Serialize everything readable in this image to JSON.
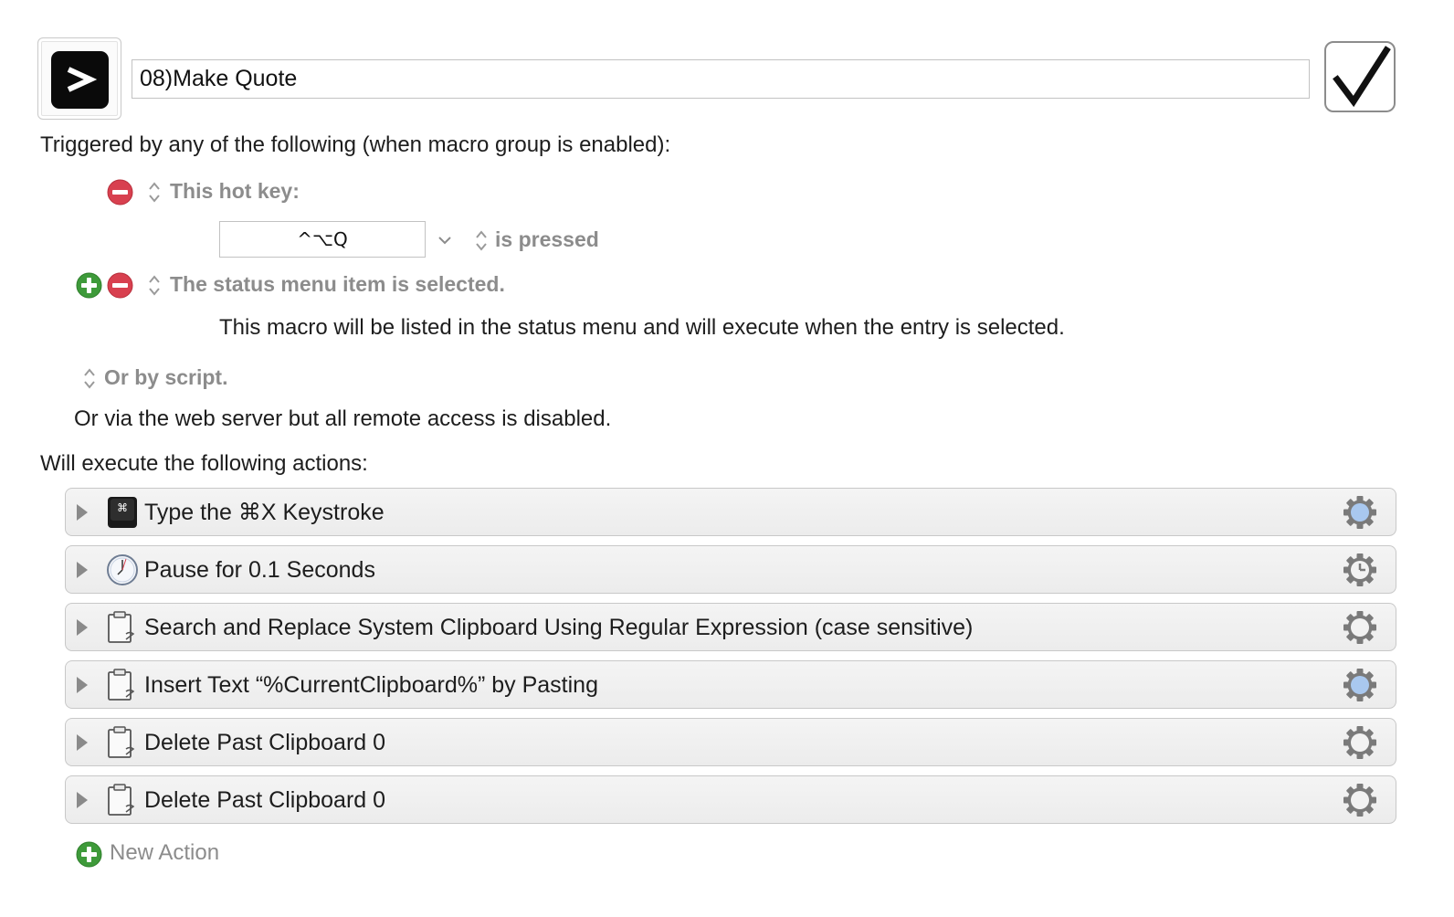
{
  "macro": {
    "name": "08)Make Quote",
    "icon": "terminal-icon",
    "enabled": true
  },
  "triggers": {
    "heading": "Triggered by any of the following (when macro group is enabled):",
    "hotkey_label": "This hot key:",
    "hotkey_value": "^⌥Q",
    "hotkey_state": "is pressed",
    "status_menu_label": "The status menu item is selected.",
    "status_menu_note": "This macro will be listed in the status menu and will execute when the entry is selected.",
    "script_label": "Or by script.",
    "web_server_note": "Or via the web server but all remote access is disabled."
  },
  "actions_heading": "Will execute the following actions:",
  "actions": [
    {
      "label": "Type the ⌘X Keystroke",
      "icon": "keystroke-icon",
      "gear": "gear-icon-highlighted"
    },
    {
      "label": "Pause for 0.1 Seconds",
      "icon": "clock-icon",
      "gear": "gear-clock-icon"
    },
    {
      "label": "Search and Replace System Clipboard Using Regular Expression (case sensitive)",
      "icon": "clipboard-icon",
      "gear": "gear-icon"
    },
    {
      "label": "Insert Text “%CurrentClipboard%” by Pasting",
      "icon": "clipboard-icon",
      "gear": "gear-icon-highlighted"
    },
    {
      "label": "Delete Past Clipboard 0",
      "icon": "clipboard-icon",
      "gear": "gear-icon"
    },
    {
      "label": "Delete Past Clipboard 0",
      "icon": "clipboard-icon",
      "gear": "gear-icon"
    }
  ],
  "new_action_label": "New Action",
  "colors": {
    "add": "#3e9a3a",
    "remove": "#d8404f",
    "muted_text": "#8c8c8c",
    "gear_highlight": "#a9c8ef"
  }
}
